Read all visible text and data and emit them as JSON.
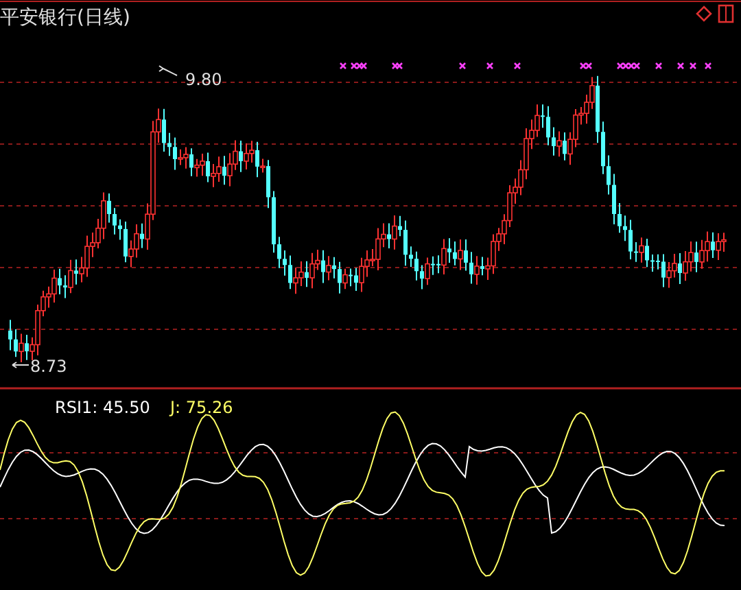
{
  "title": "平安银行(日线)",
  "price_labels": {
    "high": "9.80",
    "low": "8.73"
  },
  "indicators": [
    {
      "label": "RSI1:",
      "value": "45.50",
      "color": "#ffffff"
    },
    {
      "label": "J:",
      "value": "75.26",
      "color": "#ffff66"
    }
  ]
}
